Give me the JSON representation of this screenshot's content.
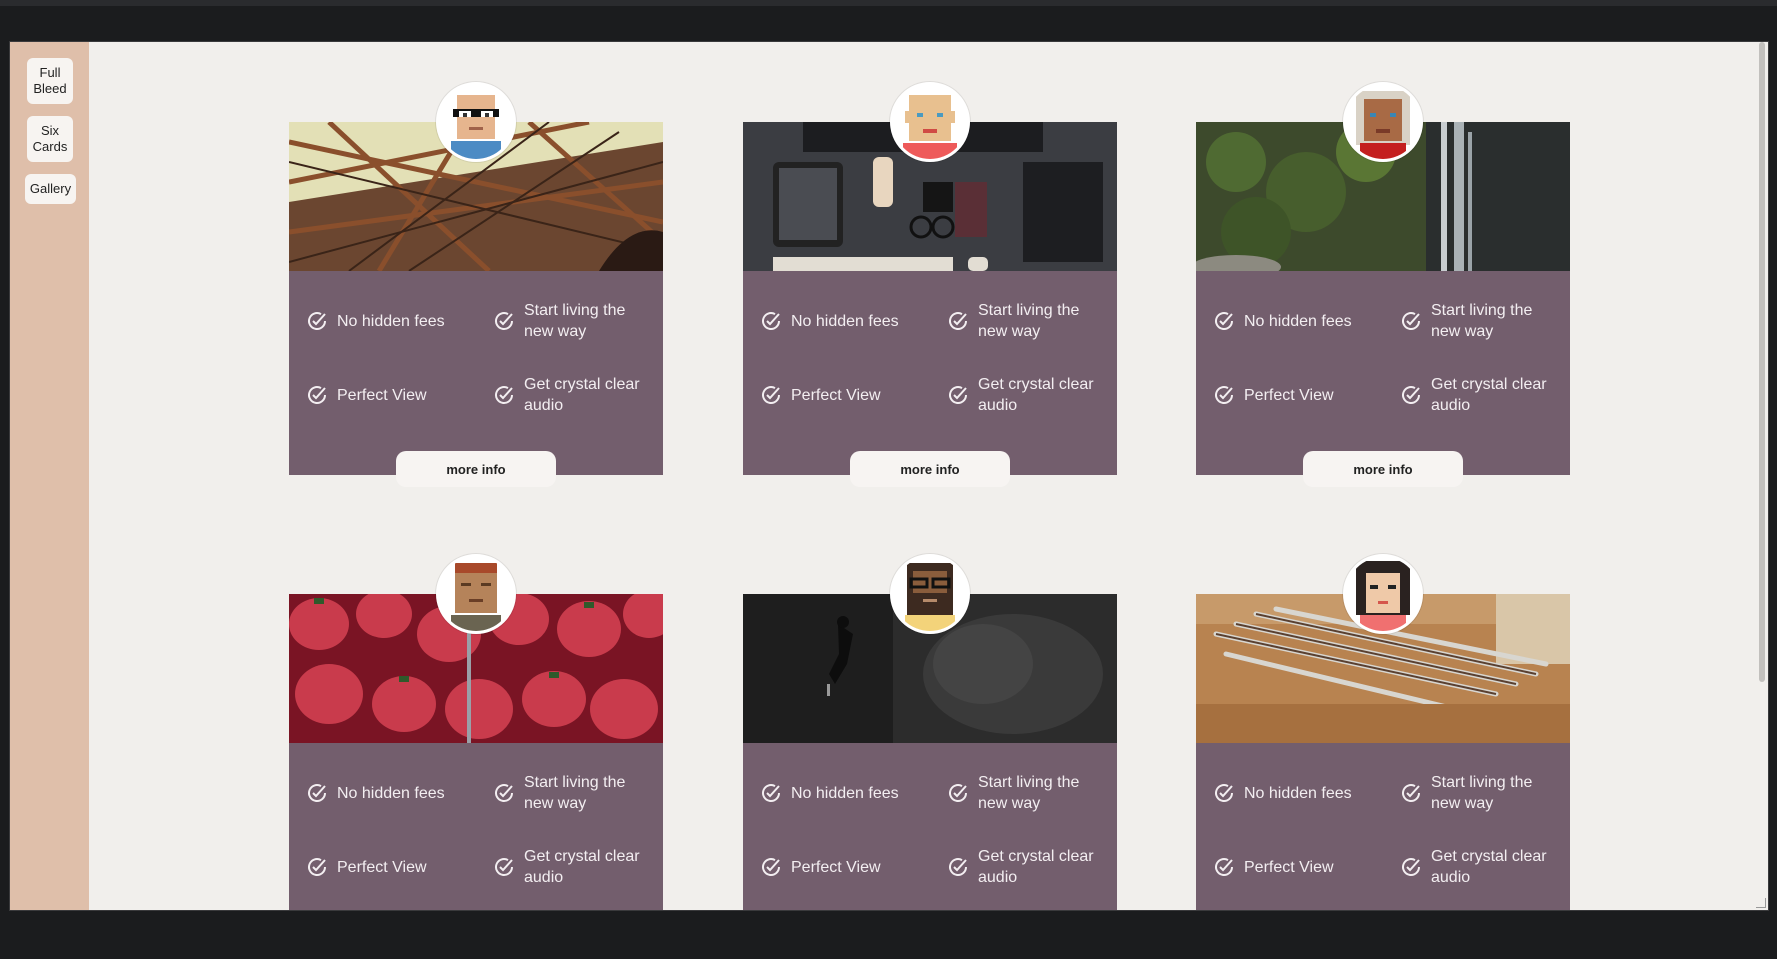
{
  "sidebar": {
    "items": [
      {
        "label": "Full\nBleed"
      },
      {
        "label": "Six\nCards"
      },
      {
        "label": "Gallery"
      }
    ]
  },
  "card_common": {
    "features": [
      "No hidden fees",
      "Start living the new way",
      "Perfect View",
      "Get crystal clear audio"
    ],
    "button_label": "more info"
  },
  "cards": [
    {
      "photo": "bridge-photo",
      "avatar": "glasses-man-avatar"
    },
    {
      "photo": "desk-photo",
      "avatar": "bald-man-avatar"
    },
    {
      "photo": "waterfall-photo",
      "avatar": "woman-avatar"
    },
    {
      "photo": "strawberries-photo",
      "avatar": "redhair-man-avatar"
    },
    {
      "photo": "diver-photo",
      "avatar": "bearded-man-avatar"
    },
    {
      "photo": "pencils-photo",
      "avatar": "darkhair-woman-avatar"
    }
  ],
  "colors": {
    "sidebar": "#dfbfaa",
    "panel": "#735e6d",
    "background": "#f1efec"
  }
}
